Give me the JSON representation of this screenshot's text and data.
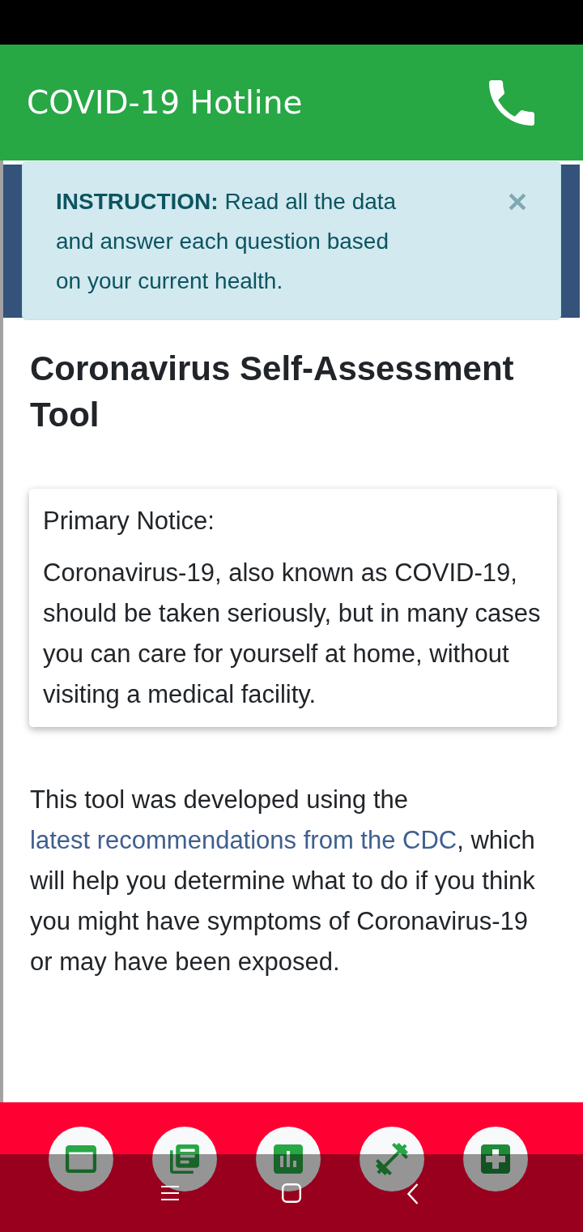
{
  "app_bar": {
    "title": "COVID-19 Hotline"
  },
  "alert": {
    "text": "**INSTRUCTION:** Read all the data and answer each question based on your current health."
  },
  "heading": "Coronavirus Self-Assessment Tool",
  "notice_card": {
    "title": "Primary Notice:",
    "text": "Coronavirus-19, also known as COVID-19, should be taken seriously, but in many cases you can care for yourself at home, without visiting a medical facility."
  },
  "intro": {
    "text_before": "This tool was developed using the ",
    "link": "latest recommendations from the CDC",
    "text_after": ", which will help you determine what to do if you think you might have symptoms of Coronavirus-19 or may have been exposed."
  },
  "bottom_nav": {
    "items": [
      {
        "kind": "window"
      },
      {
        "kind": "articles"
      },
      {
        "kind": "chart"
      },
      {
        "kind": "fitness"
      },
      {
        "kind": "medical"
      }
    ]
  },
  "system_nav": {
    "buttons": [
      {
        "kind": "recents"
      },
      {
        "kind": "home"
      },
      {
        "kind": "back"
      }
    ]
  }
}
